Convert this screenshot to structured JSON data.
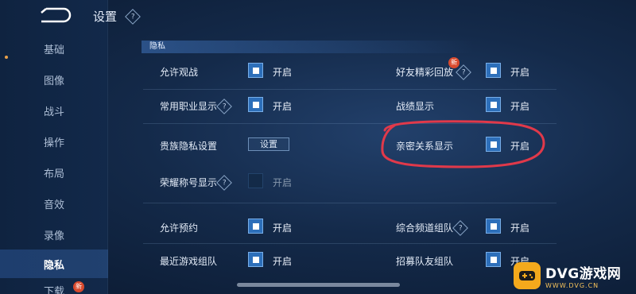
{
  "header": {
    "title": "设置",
    "help_icon": "?"
  },
  "sidebar": {
    "items": [
      {
        "label": "基础"
      },
      {
        "label": "图像"
      },
      {
        "label": "战斗"
      },
      {
        "label": "操作"
      },
      {
        "label": "布局"
      },
      {
        "label": "音效"
      },
      {
        "label": "录像"
      },
      {
        "label": "隐私",
        "active": true
      },
      {
        "label": "下载"
      }
    ],
    "new_badge": "新"
  },
  "section": {
    "label": "隐私"
  },
  "settings": {
    "allow_spectate": {
      "label": "允许观战",
      "state": "开启",
      "checked": true
    },
    "friend_highlights": {
      "label": "好友精彩回放",
      "state": "开启",
      "checked": true,
      "badge": "新"
    },
    "common_role_display": {
      "label": "常用职业显示",
      "state": "开启",
      "checked": true
    },
    "record_display": {
      "label": "战绩显示",
      "state": "开启",
      "checked": true
    },
    "noble_privacy": {
      "label": "贵族隐私设置",
      "button": "设置"
    },
    "intimate_display": {
      "label": "亲密关系显示",
      "state": "开启",
      "checked": true
    },
    "honor_title_display": {
      "label": "荣耀称号显示",
      "state": "开启",
      "checked": false
    },
    "allow_booking": {
      "label": "允许预约",
      "state": "开启",
      "checked": true
    },
    "channel_team": {
      "label": "综合频道组队",
      "state": "开启",
      "checked": true
    },
    "recent_team": {
      "label": "最近游戏组队",
      "state": "开启",
      "checked": true
    },
    "recruit_team": {
      "label": "招募队友组队",
      "state": "开启",
      "checked": true
    }
  },
  "watermark": {
    "title": "DVG游戏网",
    "url": "WWW.DVG.CN"
  },
  "colors": {
    "accent_blue": "#2d6fba",
    "annotation_red": "#e0394a",
    "watermark_orange": "#f4a91c"
  }
}
